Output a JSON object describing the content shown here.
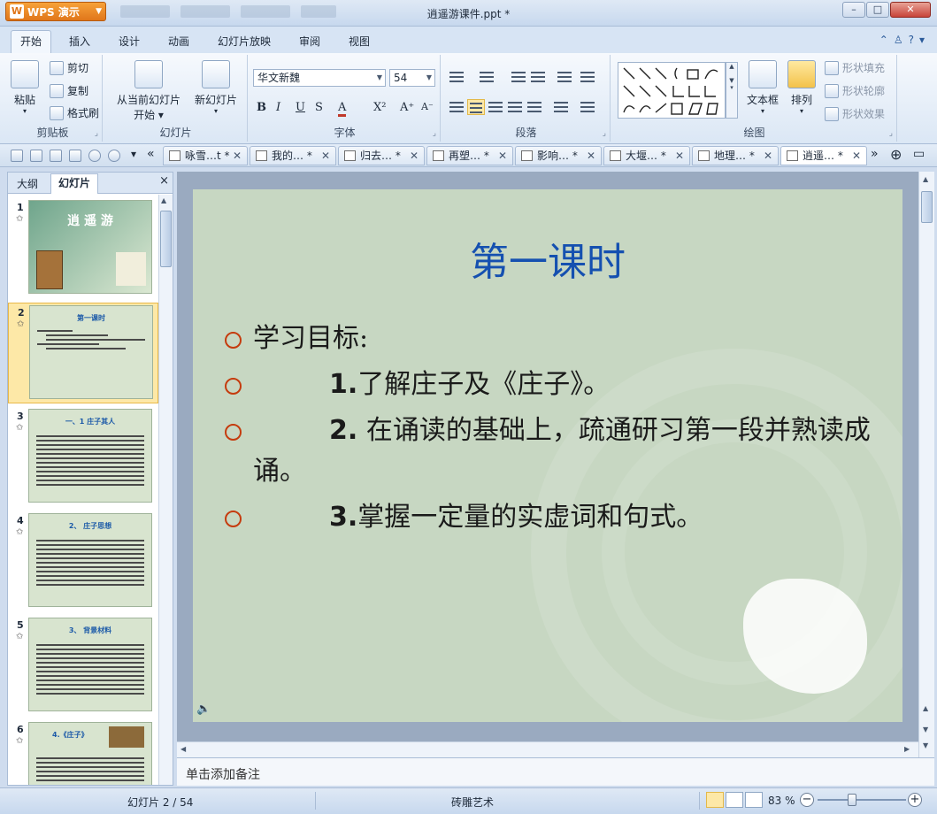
{
  "app": {
    "name": "WPS 演示",
    "document_title": "逍遥游课件.ppt *"
  },
  "window_controls": {
    "minimize": "–",
    "maximize": "□",
    "close": "✕"
  },
  "ribbon": {
    "tabs": [
      "开始",
      "插入",
      "设计",
      "动画",
      "幻灯片放映",
      "审阅",
      "视图"
    ],
    "clipboard": {
      "paste": "粘贴",
      "cut": "剪切",
      "copy": "复制",
      "format_painter": "格式刷",
      "label": "剪贴板"
    },
    "slides": {
      "from_current": "从当前幻灯片",
      "start": "开始",
      "new_slide": "新幻灯片",
      "label": "幻灯片"
    },
    "font": {
      "family": "华文新魏",
      "size": "54",
      "label": "字体"
    },
    "paragraph": {
      "label": "段落"
    },
    "drawing": {
      "textbox": "文本框",
      "arrange": "排列",
      "shape_fill": "形状填充",
      "shape_outline": "形状轮廓",
      "shape_effect": "形状效果",
      "label": "绘图"
    }
  },
  "doc_tabs": [
    {
      "label": "咏雪…t *"
    },
    {
      "label": "我的… *"
    },
    {
      "label": "归去… *"
    },
    {
      "label": "再塑… *"
    },
    {
      "label": "影响… *"
    },
    {
      "label": "大堰… *"
    },
    {
      "label": "地理… *"
    },
    {
      "label": "逍遥… *"
    }
  ],
  "left_panel": {
    "tabs": [
      "大纲",
      "幻灯片"
    ],
    "close": "×",
    "star": "✩",
    "thumbnails": [
      {
        "num": "1",
        "title": "逍 遥 游"
      },
      {
        "num": "2",
        "title": "第一课时"
      },
      {
        "num": "3",
        "title": "一、1 庄子其人"
      },
      {
        "num": "4",
        "title": "2、 庄子思想"
      },
      {
        "num": "5",
        "title": "3、 背景材料"
      },
      {
        "num": "6",
        "title": "4.《庄子》"
      }
    ]
  },
  "slide": {
    "title": "第一课时",
    "bullets": [
      {
        "num": "",
        "text": "学习目标:"
      },
      {
        "num": "1.",
        "text": "了解庄子及《庄子》。"
      },
      {
        "num": "2.",
        "text": " 在诵读的基础上，疏通研习第一段并熟读成诵。"
      },
      {
        "num": "3.",
        "text": "掌握一定量的实虚词和句式。"
      }
    ],
    "speaker_icon": "🔈"
  },
  "notes_placeholder": "单击添加备注",
  "status": {
    "slide_index": "幻灯片 2 / 54",
    "theme": "砖雕艺术",
    "zoom": "83 %",
    "zoom_out": "−",
    "zoom_in": "+"
  },
  "colors": {
    "slide_title": "#1550b0",
    "bullet_marker": "#c53b0d",
    "selected_thumb": "#fde8a7",
    "app_button": "#e0761a"
  },
  "icons": [
    "wps-logo-icon",
    "help-icon",
    "cut-icon",
    "copy-icon",
    "format-painter-icon",
    "open-icon",
    "save-icon",
    "print-icon",
    "undo-icon",
    "redo-icon",
    "speaker-icon"
  ]
}
